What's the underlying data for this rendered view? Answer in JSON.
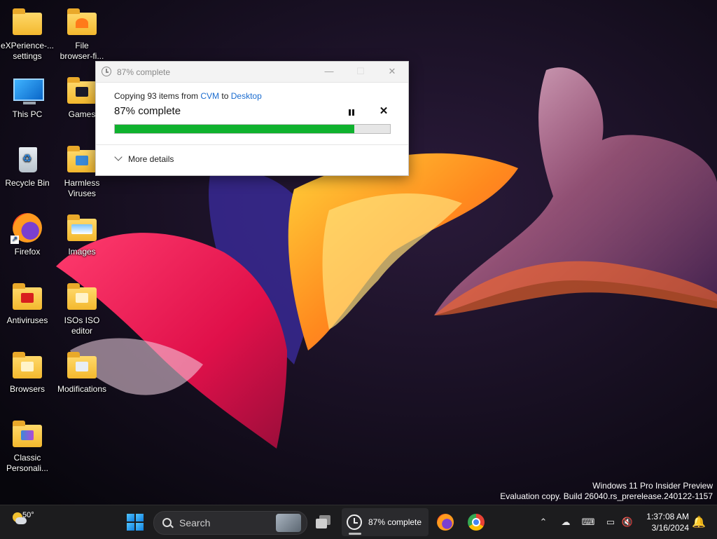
{
  "desktop": {
    "icons": [
      {
        "label": "eXPerience-...\nsettings"
      },
      {
        "label": "File\nbrowser-fi..."
      },
      {
        "label": "This PC"
      },
      {
        "label": "Games"
      },
      {
        "label": "Recycle Bin"
      },
      {
        "label": "Harmless\nViruses"
      },
      {
        "label": "Firefox"
      },
      {
        "label": "Images"
      },
      {
        "label": "Antiviruses"
      },
      {
        "label": "ISOs ISO\neditor"
      },
      {
        "label": "Browsers"
      },
      {
        "label": "Modifications"
      },
      {
        "label": "Classic\nPersonali..."
      }
    ]
  },
  "dialog": {
    "title": "87% complete",
    "copy_prefix": "Copying 93 items from ",
    "source": "CVM",
    "to_word": " to ",
    "destination": "Desktop",
    "percent_text": "87% complete",
    "progress_fraction": 0.87,
    "more_details": "More details",
    "minimize_icon": "minimize-icon",
    "maximize_icon": "maximize-icon",
    "close_icon": "close-icon"
  },
  "watermark": {
    "line1": "Windows 11 Pro Insider Preview",
    "line2": "Evaluation copy. Build 26040.rs_prerelease.240122-1157"
  },
  "taskbar": {
    "weather_temp": "50°",
    "search_placeholder": "Search",
    "copy_task_label": "87% complete",
    "clock_time": "1:37:08 AM",
    "clock_date": "3/16/2024"
  },
  "colors": {
    "progress": "#0fb22e",
    "link": "#1a6ccf",
    "taskbar": "#1c1c1e"
  }
}
